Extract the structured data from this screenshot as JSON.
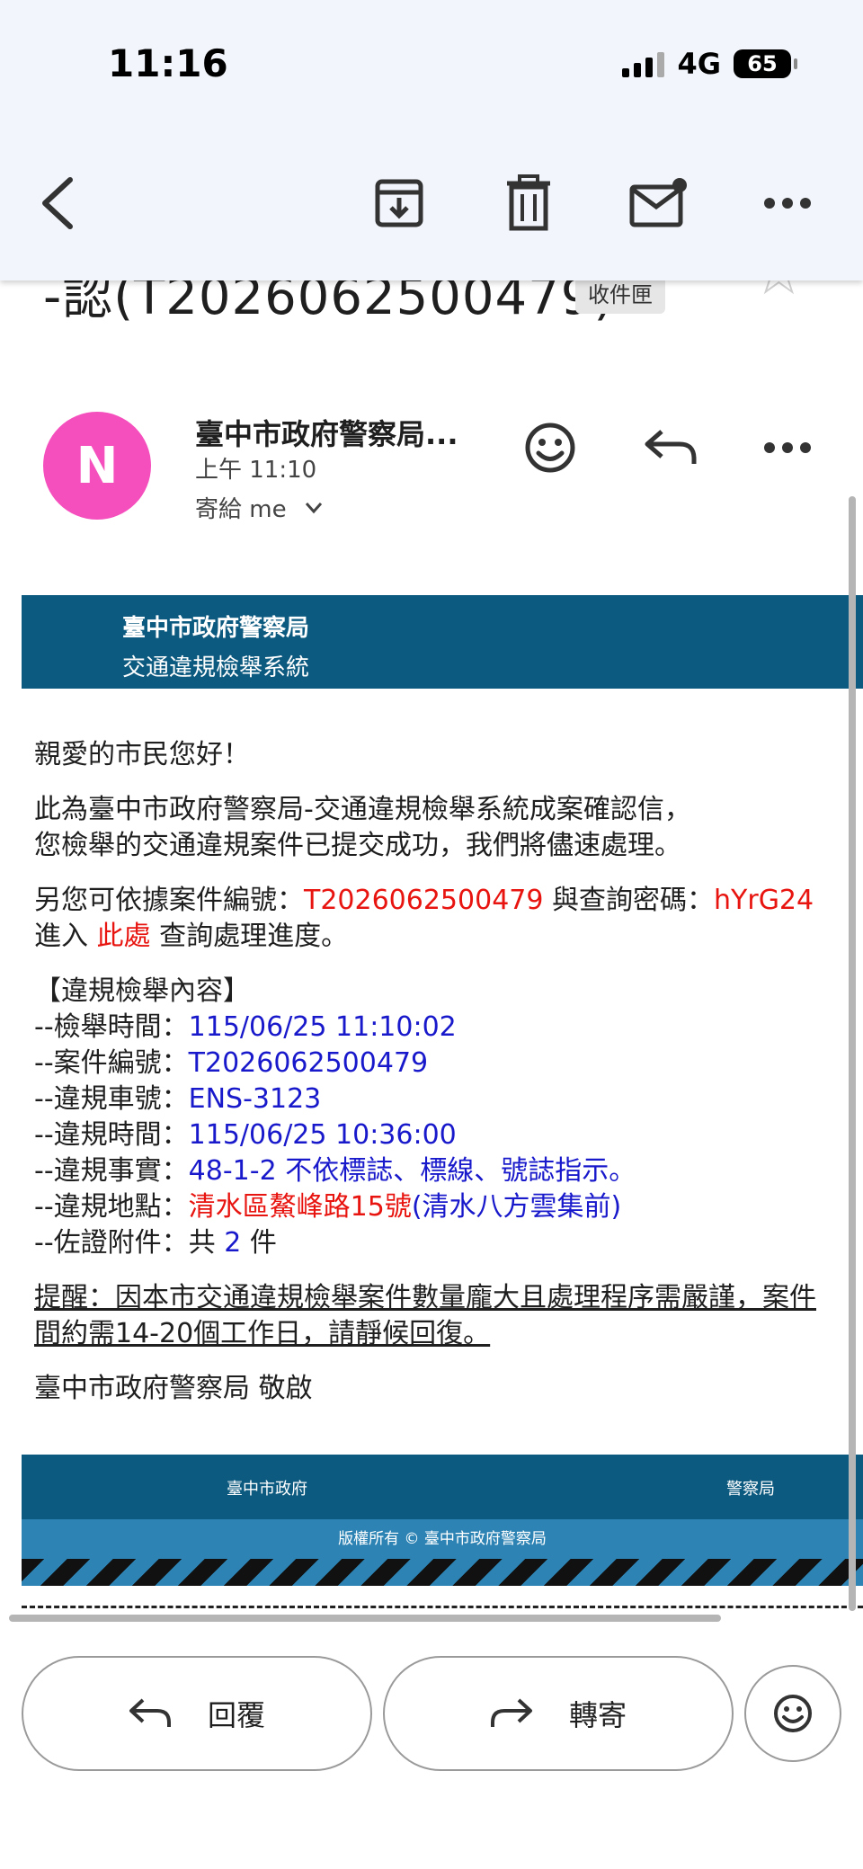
{
  "status_bar": {
    "time": "11:16",
    "network": "4G",
    "battery": "65"
  },
  "toolbar": {
    "back_icon": "back-arrow-icon",
    "archive_icon": "archive-icon",
    "delete_icon": "trash-icon",
    "unread_icon": "mark-unread-icon",
    "more_icon": "more-icon"
  },
  "subject": {
    "visible_text": "-認(T2026062500479)",
    "label": "收件匣"
  },
  "sender": {
    "initial": "N",
    "name": "臺中市政府警察局...",
    "time": "上午 11:10",
    "to": "寄給 me",
    "avatar_color": "#f54fbd"
  },
  "email": {
    "header_org": "臺中市政府警察局",
    "header_system": "交通違規檢舉系統",
    "greeting": "親愛的市民您好！",
    "intro_line1": "此為臺中市政府警察局-交通違規檢舉系統成案確認信，",
    "intro_line2": "您檢舉的交通違規案件已提交成功，我們將儘速處理。",
    "lookup_prefix": "另您可依據案件編號：",
    "lookup_case_no": "T2026062500479",
    "lookup_mid": " 與查詢密碼：",
    "lookup_password": "hYrG24",
    "enter_prefix": "進入 ",
    "enter_link": "此處",
    "enter_suffix": " 查詢處理進度。",
    "section_title": "【違規檢舉內容】",
    "report_time_label": "--檢舉時間：",
    "report_time": "115/06/25 11:10:02",
    "case_no_label": "--案件編號：",
    "case_no": "T2026062500479",
    "plate_label": "--違規車號：",
    "plate": "ENS-3123",
    "violation_time_label": "--違規時間：",
    "violation_time": "115/06/25 10:36:00",
    "violation_fact_label": "--違規事實：",
    "violation_fact": "48-1-2 不依標誌、標線、號誌指示。",
    "location_label": "--違規地點：",
    "location_red": "清水區鰲峰路15號",
    "location_blue": "(清水八方雲集前)",
    "attach_label": "--佐證附件：",
    "attach_prefix": "共 ",
    "attach_count": "2",
    "attach_suffix": " 件",
    "reminder_line1": "提醒：因本市交通違規檢舉案件數量龐大且處理程序需嚴謹，案件",
    "reminder_line2": "間約需14-20個工作日，請靜候回復。",
    "signoff": "臺中市政府警察局 敬啟",
    "footer_left": "臺中市政府",
    "footer_right": "警察局",
    "copyright": "版權所有 © 臺中市政府警察局",
    "header_color": "#0c5a80"
  },
  "actions": {
    "reply": "回覆",
    "forward": "轉寄"
  }
}
